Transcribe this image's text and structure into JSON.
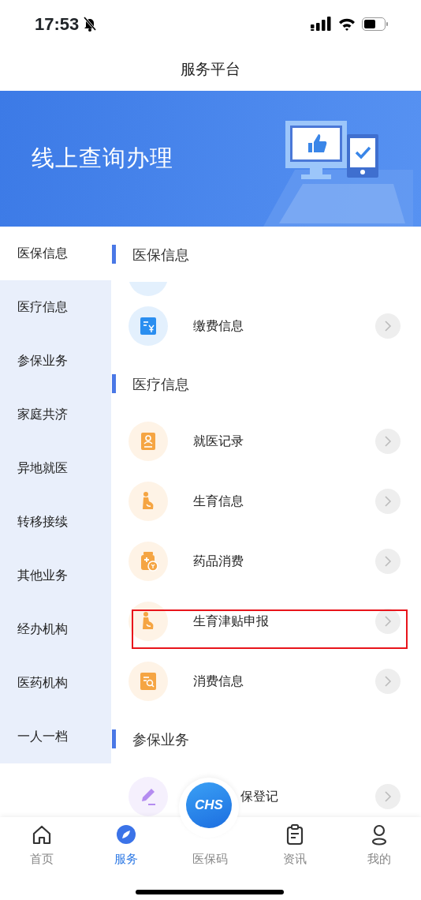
{
  "status_bar": {
    "time": "17:53"
  },
  "title": "服务平台",
  "banner": {
    "title": "线上查询办理"
  },
  "sidebar": {
    "items": [
      {
        "label": "医保信息",
        "selected": true
      },
      {
        "label": "医疗信息",
        "selected": false
      },
      {
        "label": "参保业务",
        "selected": false
      },
      {
        "label": "家庭共济",
        "selected": false
      },
      {
        "label": "异地就医",
        "selected": false
      },
      {
        "label": "转移接续",
        "selected": false
      },
      {
        "label": "其他业务",
        "selected": false
      },
      {
        "label": "经办机构",
        "selected": false
      },
      {
        "label": "医药机构",
        "selected": false
      },
      {
        "label": "一人一档",
        "selected": false
      }
    ]
  },
  "content": [
    {
      "kind": "section",
      "title": "医保信息"
    },
    {
      "kind": "partial"
    },
    {
      "kind": "payment",
      "color": "#2a8ef0",
      "label": "缴费信息",
      "highlighted": false
    },
    {
      "kind": "section",
      "title": "医疗信息"
    },
    {
      "kind": "record",
      "color": "#f5a543",
      "label": "就医记录",
      "highlighted": false
    },
    {
      "kind": "maternity",
      "color": "#f5a543",
      "label": "生育信息",
      "highlighted": false
    },
    {
      "kind": "medicine",
      "color": "#f5a543",
      "label": "药品消费",
      "highlighted": false
    },
    {
      "kind": "maternity",
      "color": "#f5a543",
      "label": "生育津贴申报",
      "highlighted": true
    },
    {
      "kind": "bill-search",
      "color": "#f5a543",
      "label": "消费信息",
      "highlighted": false
    },
    {
      "kind": "section",
      "title": "参保业务"
    },
    {
      "kind": "edit",
      "color": "#b48cf0",
      "label": "保登记",
      "covered": true,
      "highlighted": false
    }
  ],
  "tab_bar": {
    "items": [
      {
        "kind": "home",
        "label": "首页",
        "selected": false
      },
      {
        "kind": "service",
        "label": "服务",
        "selected": true
      },
      {
        "kind": "code",
        "label": "医保码",
        "logo": "CHS",
        "selected": false
      },
      {
        "kind": "news",
        "label": "资讯",
        "selected": false
      },
      {
        "kind": "me",
        "label": "我的",
        "selected": false
      }
    ]
  }
}
